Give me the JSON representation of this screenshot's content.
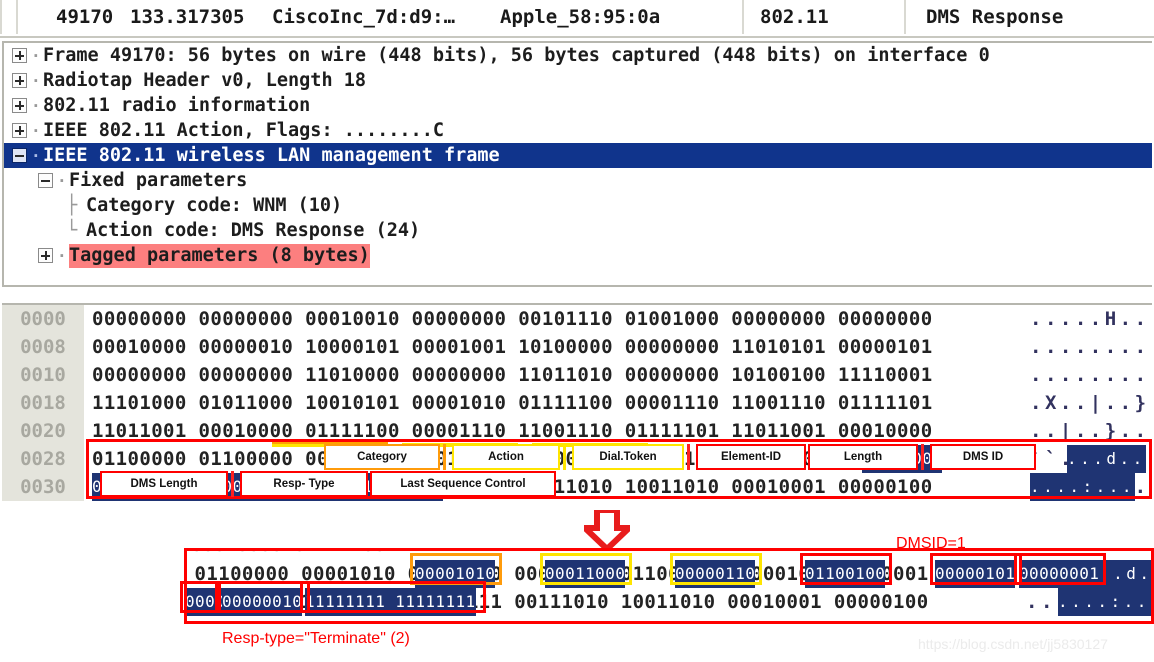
{
  "packet_list": {
    "no": "49170",
    "time": "133.317305",
    "source": "CiscoInc_7d:d9:…",
    "destination": "Apple_58:95:0a",
    "protocol": "802.11",
    "info": "DMS Response"
  },
  "detail_tree": [
    {
      "expander": "plus",
      "label": "Frame 49170: 56 bytes on wire (448 bits), 56 bytes captured (448 bits) on interface 0",
      "indent": 1,
      "state": "normal"
    },
    {
      "expander": "plus",
      "label": "Radiotap Header v0, Length 18",
      "indent": 1,
      "state": "normal"
    },
    {
      "expander": "plus",
      "label": "802.11 radio information",
      "indent": 1,
      "state": "normal"
    },
    {
      "expander": "plus",
      "label": "IEEE 802.11 Action, Flags: ........C",
      "indent": 1,
      "state": "normal"
    },
    {
      "expander": "minus",
      "label": "IEEE 802.11 wireless LAN management frame",
      "indent": 1,
      "state": "selected"
    },
    {
      "expander": "minus",
      "label": "Fixed parameters",
      "indent": 2,
      "state": "normal"
    },
    {
      "expander": "leaf",
      "label": "Category code: WNM (10)",
      "indent": 3,
      "state": "normal"
    },
    {
      "expander": "leaf",
      "label": "Action code: DMS Response (24)",
      "indent": 3,
      "state": "normal"
    },
    {
      "expander": "plus",
      "label": "Tagged parameters (8 bytes)",
      "indent": 2,
      "state": "highlighted"
    }
  ],
  "hex_pane": {
    "rows": [
      {
        "offset": "0000",
        "bytes": "00000000 00000000 00010010 00000000 00101110 01001000 00000000 00000000",
        "ascii": ".....H.."
      },
      {
        "offset": "0008",
        "bytes": "00010000 00000010 10000101 00001001 10100000 00000000 11010101 00000101",
        "ascii": "........"
      },
      {
        "offset": "0010",
        "bytes": "00000000 00000000 11010000 00000000 11011010 00000000 10100100 11110001",
        "ascii": "........"
      },
      {
        "offset": "0018",
        "bytes": "11101000 01011000 10010101 00001010 01111100 00001110 11001110 01111101",
        "ascii": ".X..|..}"
      },
      {
        "offset": "0020",
        "bytes": "11011001 00010000 01111100 00001110 11001110 01111101 11011001 00010000",
        "ascii": "..|..}.."
      },
      {
        "offset": "0028",
        "bytes": "01100000 01100000 00001010 00011000 00000110 01100100 00000101 00000001",
        "ascii": "``...d.."
      },
      {
        "offset": "0030",
        "bytes": "00000011 00000010 11111111 11111111 00111010 10011010 00010001 00000100",
        "ascii": "....:..."
      }
    ]
  },
  "annotations": {
    "row_0028": [
      {
        "label": "Category",
        "color": "orange"
      },
      {
        "label": "Action",
        "color": "yellow"
      },
      {
        "label": "Dial.Token",
        "color": "yellow"
      },
      {
        "label": "Element-ID",
        "color": "red"
      },
      {
        "label": "Length",
        "color": "red"
      },
      {
        "label": "DMS ID",
        "color": "red"
      }
    ],
    "row_0030": [
      {
        "label": "DMS Length",
        "color": "red"
      },
      {
        "label": "Resp- Type",
        "color": "red"
      },
      {
        "label": "Last Sequence Control",
        "color": "red"
      }
    ]
  },
  "bottom_panel": {
    "rows": [
      {
        "bytes": "01100000 01100000 00001010 00011000 00000110 01100100 00000101 00000001",
        "ascii": "``...d.."
      },
      {
        "bytes": "00000011 00000010 11111111 11111111 00111010 10011010 00010001 00000100",
        "ascii": "....:..."
      }
    ]
  },
  "captions": {
    "dmsid": "DMSID=1",
    "resp_type": "Resp-type=\"Terminate\"  (2)"
  },
  "watermark": "https://blog.csdn.net/jj5830127",
  "colors": {
    "selection_navy": "#1f3473",
    "highlight_red": "#fc7f7f",
    "annotation_red": "#ff0000",
    "annotation_yellow": "#ffe500",
    "annotation_orange": "#ff9b0b",
    "offset_gutter": "#e4e4dc"
  }
}
